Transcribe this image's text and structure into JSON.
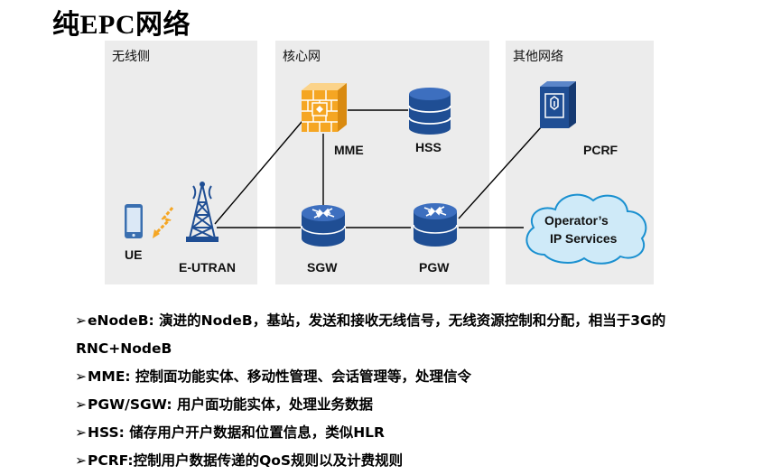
{
  "title": "纯EPC网络",
  "zones": {
    "wireless": "无线侧",
    "core": "核心网",
    "other": "其他网络"
  },
  "nodes": {
    "ue": "UE",
    "eutran": "E-UTRAN",
    "mme": "MME",
    "hss": "HSS",
    "sgw": "SGW",
    "pgw": "PGW",
    "pcrf": "PCRF",
    "ip_services_line1": "Operator’s",
    "ip_services_line2": "IP Services"
  },
  "bullet_marker": "➢",
  "bullets": [
    "eNodeB: 演进的NodeB，基站，发送和接收无线信号，无线资源控制和分配，相当于3G的",
    "RNC+NodeB",
    "MME: 控制面功能实体、移动性管理、会话管理等，处理信令",
    "PGW/SGW: 用户面功能实体，处理业务数据",
    "HSS: 储存用户开户数据和位置信息，类似HLR",
    "PCRF:控制用户数据传递的QoS规则以及计费规则"
  ],
  "colors": {
    "zone_bg": "#ececec",
    "database_blue": "#1f4e94",
    "firewall_orange": "#f5a623",
    "cloud_fill": "#cfeaf8",
    "cloud_stroke": "#1a90d0",
    "spark": "#f5a623"
  },
  "icons": {
    "ue": "mobile-phone-icon",
    "eutran": "cell-tower-icon",
    "mme": "firewall-icon",
    "hss": "database-icon",
    "sgw": "router-icon",
    "pgw": "router-icon",
    "pcrf": "server-icon",
    "ip_services": "cloud-icon"
  }
}
